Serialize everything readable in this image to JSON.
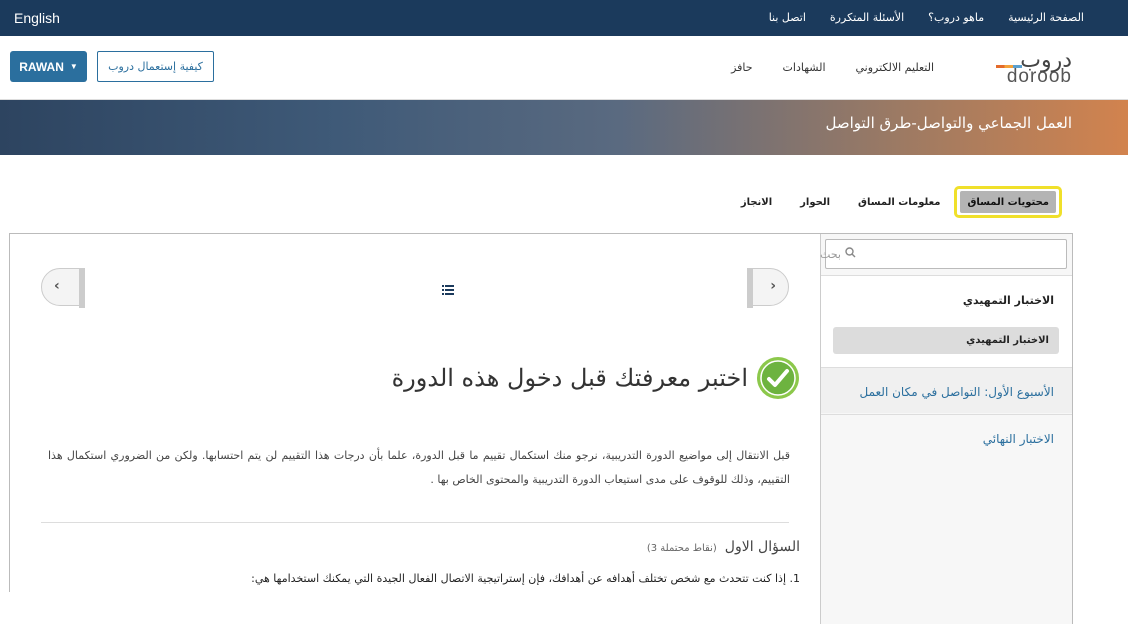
{
  "topbar": {
    "language": "English",
    "menu": [
      "الصفحة الرئيسية",
      "ماهو دروب؟",
      "الأسئلة المتكررة",
      "اتصل بنا"
    ]
  },
  "header": {
    "user_label": "RAWAN",
    "how_to_label": "كيفية إستعمال دروب",
    "nav": [
      "التعليم الالكتروني",
      "الشهادات",
      "حافز"
    ],
    "logo_ar": "دروب",
    "logo_en": "doroob"
  },
  "banner": {
    "title": "العمل الجماعي والتواصل-طرق التواصل"
  },
  "tabs": [
    "محتويات المساق",
    "معلومات المساق",
    "الحوار",
    "الانجاز"
  ],
  "sidebar": {
    "search_placeholder": "بحث",
    "section_title": "الاختبار التمهيدي",
    "active_item": "الاختبار التمهيدي",
    "week1": "الأسبوع الأول: التواصل في مكان العمل",
    "final_exam": "الاختبار النهائي"
  },
  "content": {
    "heading": "اختبر معرفتك قبل دخول هذه الدورة",
    "intro": "قبل الانتقال إلى مواضيع الدورة التدريبية، نرجو منك استكمال تقييم ما قبل الدورة، علما بأن درجات هذا التقييم لن يتم احتسابها. ولكن من الضروري استكمال هذا التقييم، وذلك للوقوف على مدى استيعاب الدورة التدريبية والمحتوى الخاص بها .",
    "question_title": "السؤال الاول",
    "question_points": "(3 نقاط محتملة)",
    "question_text": "1. إذا كنت تتحدث مع شخص تختلف أهدافه عن أهدافك، فإن إستراتيجية الاتصال الفعال الجيدة التي يمكنك استخدامها هي:"
  },
  "colors": {
    "topbar": "#1b3a5c",
    "accent": "#2b6f9e",
    "highlight": "#f0e02a",
    "badge": "#6db33f"
  }
}
